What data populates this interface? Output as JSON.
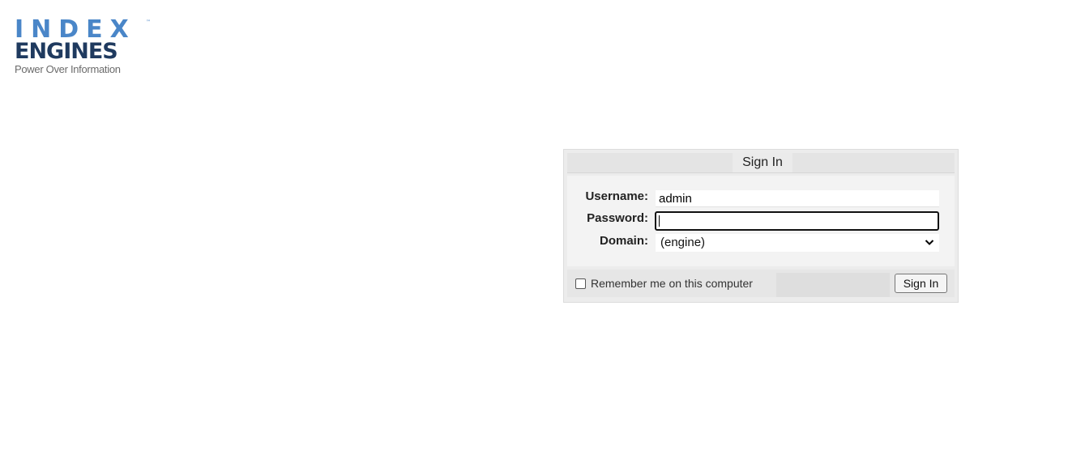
{
  "logo": {
    "word1": "INDEX",
    "trademark": "™",
    "word2": "ENGINES",
    "tagline": "Power Over Information"
  },
  "signin": {
    "title": "Sign In",
    "username_label": "Username:",
    "username_value": "admin",
    "password_label": "Password:",
    "password_value": "",
    "domain_label": "Domain:",
    "domain_selected": "(engine)",
    "domain_chevron": "❯",
    "remember_label": "Remember me on this computer",
    "remember_checked": false,
    "button_label": "Sign In"
  },
  "colors": {
    "logo_blue": "#4a86c8",
    "logo_navy": "#1f3a5f",
    "panel_bg": "#ececec"
  }
}
